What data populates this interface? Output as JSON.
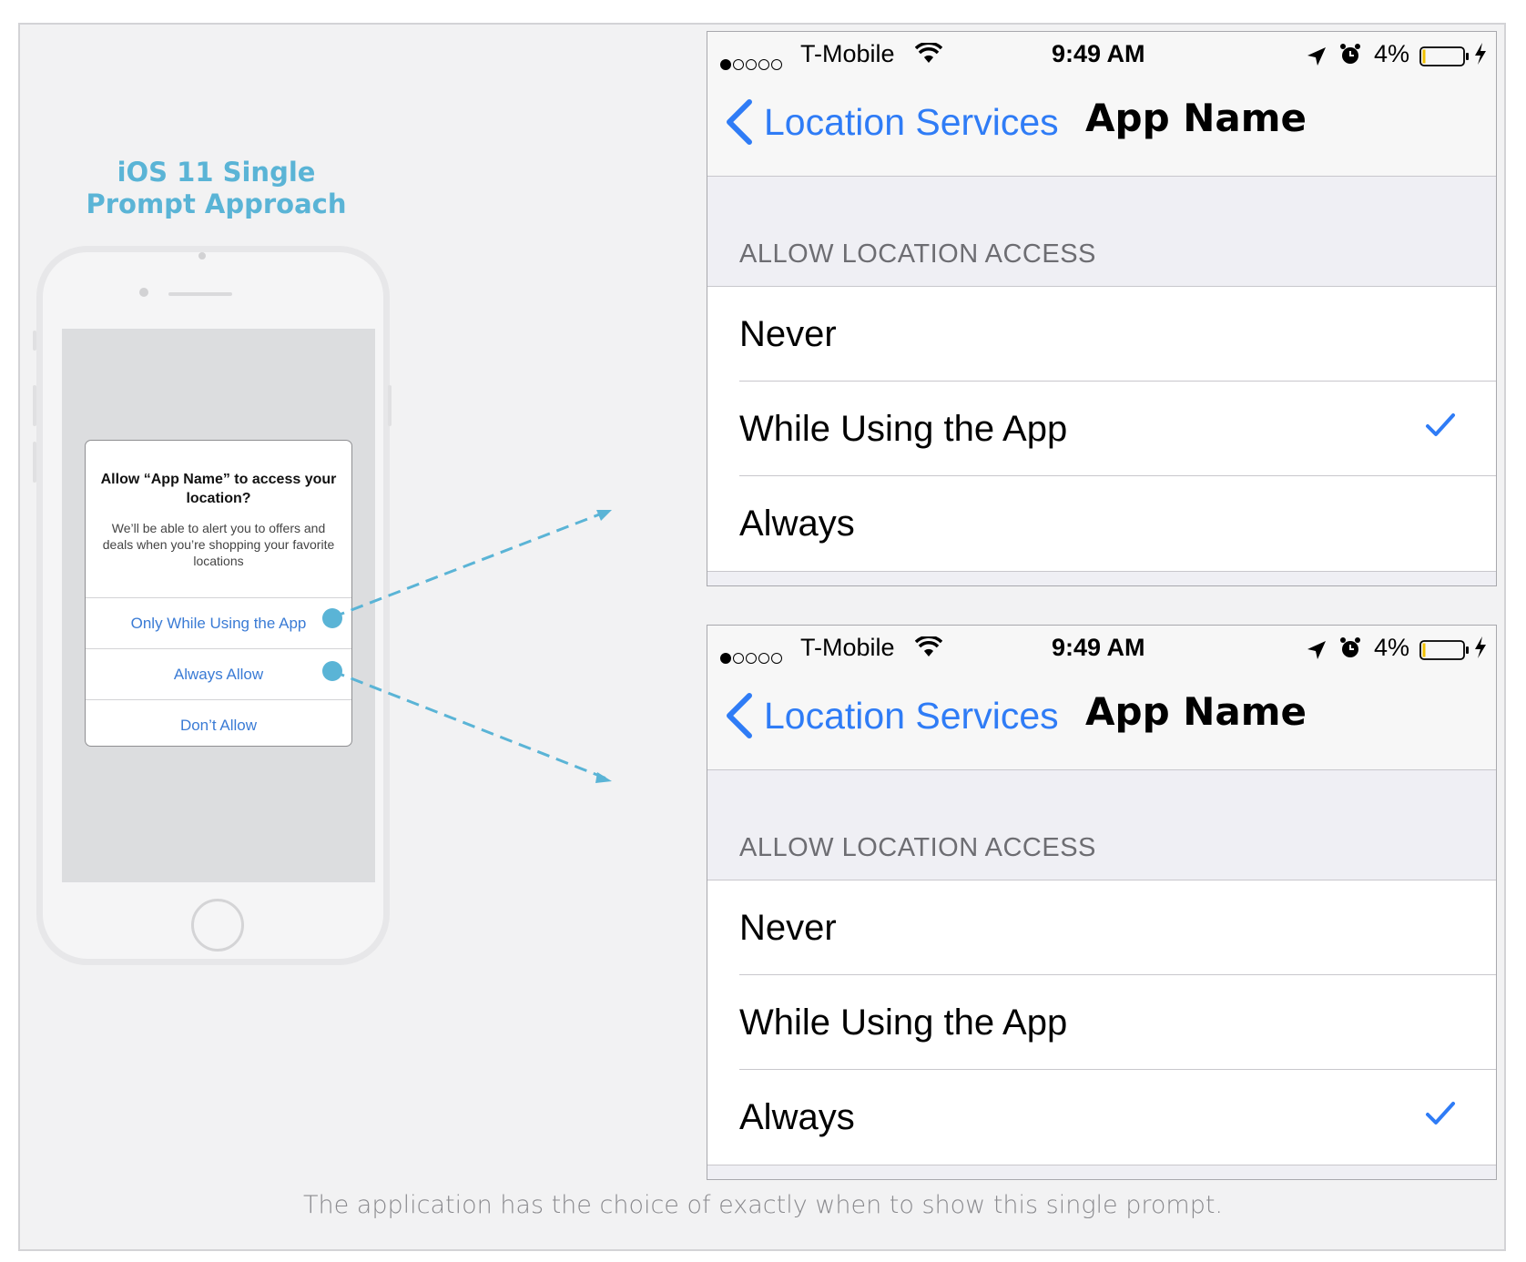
{
  "heading": {
    "line1": "iOS 11 Single",
    "line2": "Prompt Approach"
  },
  "alert": {
    "title": "Allow “App Name” to access your location?",
    "message": "We’ll be able to alert you to offers and deals when you’re shopping your favorite locations",
    "buttons": [
      "Only While Using the App",
      "Always Allow",
      "Don’t Allow"
    ]
  },
  "screens": [
    {
      "status": {
        "carrier": "T-Mobile",
        "time": "9:49 AM",
        "battery": "4%"
      },
      "back": "Location Services",
      "title": "App Name",
      "section_header": "ALLOW LOCATION ACCESS",
      "options": [
        "Never",
        "While Using the App",
        "Always"
      ],
      "selected": "While Using the App"
    },
    {
      "status": {
        "carrier": "T-Mobile",
        "time": "9:49 AM",
        "battery": "4%"
      },
      "back": "Location Services",
      "title": "App Name",
      "section_header": "ALLOW LOCATION ACCESS",
      "options": [
        "Never",
        "While Using the App",
        "Always"
      ],
      "selected": "Always"
    }
  ],
  "caption": "The application has the choice of exactly when to show this single prompt.",
  "colors": {
    "accent_teal": "#5ab4d6",
    "ios_blue": "#2f7cf6",
    "alert_link": "#3a7bd5"
  },
  "icons": [
    "wifi-icon",
    "location-arrow-icon",
    "alarm-icon",
    "battery-icon",
    "charging-bolt-icon",
    "back-chevron-icon",
    "checkmark-icon"
  ]
}
